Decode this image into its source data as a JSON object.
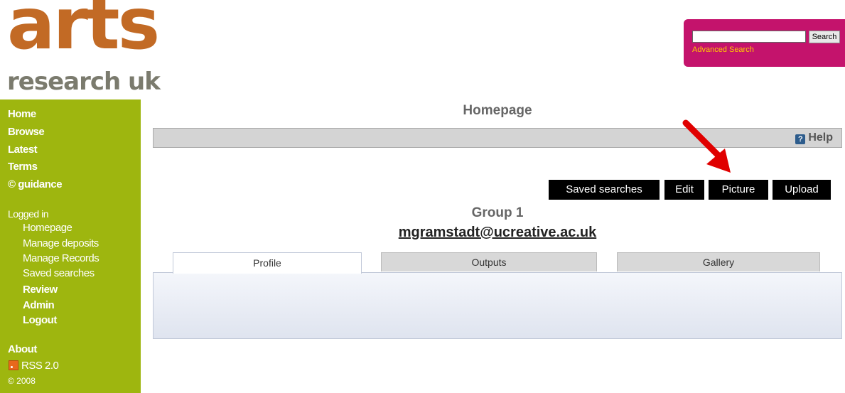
{
  "logo": {
    "line1": "arts",
    "line2": "research uk"
  },
  "search": {
    "value": "",
    "button_label": "Search",
    "advanced_label": "Advanced Search"
  },
  "sidebar": {
    "main_links": [
      {
        "label": "Home"
      },
      {
        "label": "Browse"
      },
      {
        "label": "Latest"
      },
      {
        "label": "Terms"
      },
      {
        "label": "© guidance"
      }
    ],
    "logged_in_label": "Logged in",
    "user_links": [
      {
        "label": "Homepage"
      },
      {
        "label": "Manage deposits"
      },
      {
        "label": "Manage Records"
      },
      {
        "label": "Saved searches"
      },
      {
        "label": "Review"
      },
      {
        "label": "Admin"
      },
      {
        "label": "Logout"
      }
    ],
    "about_label": "About",
    "rss_label": "RSS 2.0",
    "copyright": "© 2008"
  },
  "main": {
    "page_title": "Homepage",
    "help_label": "Help",
    "actions": [
      {
        "label": "Saved searches"
      },
      {
        "label": "Edit"
      },
      {
        "label": "Picture"
      },
      {
        "label": "Upload"
      }
    ],
    "group_name": "Group 1",
    "group_email": "mgramstadt@ucreative.ac.uk",
    "tabs": [
      {
        "label": "Profile",
        "active": true
      },
      {
        "label": "Outputs",
        "active": false
      },
      {
        "label": "Gallery",
        "active": false
      }
    ]
  },
  "colors": {
    "sidebar_green": "#9eb60f",
    "search_magenta": "#c4136c",
    "logo_orange": "#c26a25",
    "annotation_arrow": "#e00000"
  }
}
